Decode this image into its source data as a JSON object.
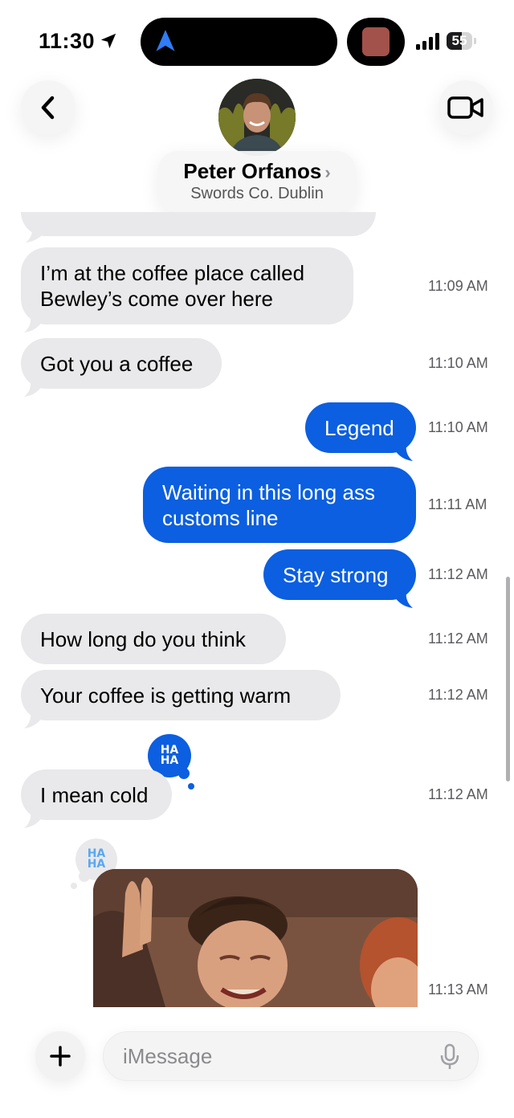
{
  "status_bar": {
    "time": "11:30",
    "battery": "55"
  },
  "header": {
    "contact_name": "Peter Orfanos",
    "contact_chevron": "›",
    "contact_subtitle": "Swords Co. Dublin"
  },
  "messages": [
    {
      "direction": "incoming",
      "text": "I’m at the coffee place called\nBewley’s come over here",
      "time": "11:09 AM"
    },
    {
      "direction": "incoming",
      "text": "Got you a coffee",
      "time": "11:10 AM"
    },
    {
      "direction": "outgoing",
      "text": "Legend",
      "time": "11:10 AM"
    },
    {
      "direction": "outgoing",
      "text": "Waiting in this long ass\ncustoms line",
      "time": "11:11 AM"
    },
    {
      "direction": "outgoing",
      "text": "Stay strong",
      "time": "11:12 AM"
    },
    {
      "direction": "incoming",
      "text": "How long do you think",
      "time": "11:12 AM"
    },
    {
      "direction": "incoming",
      "text": "Your coffee is getting warm",
      "time": "11:12 AM"
    },
    {
      "direction": "incoming",
      "text": "I mean cold",
      "time": "11:12 AM",
      "reaction": "HA HA"
    },
    {
      "direction": "incoming",
      "type": "gif",
      "time": "11:13 AM",
      "reaction": "HA HA"
    }
  ],
  "composer": {
    "placeholder": "iMessage"
  },
  "icons": {
    "location": "location-arrow-icon",
    "navigation": "navigation-arrow-icon",
    "signal": "signal-bars-icon",
    "battery": "battery-icon",
    "back": "chevron-left-icon",
    "video": "video-camera-icon",
    "plus": "plus-icon",
    "mic": "microphone-icon"
  },
  "colors": {
    "outgoing_bubble": "#0b5fe0",
    "incoming_bubble": "#e9e9eb",
    "reaction_text": "#5aa8f0"
  }
}
